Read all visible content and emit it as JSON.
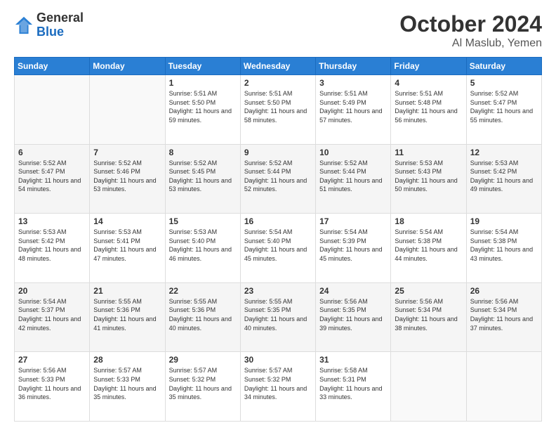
{
  "logo": {
    "general": "General",
    "blue": "Blue"
  },
  "title": "October 2024",
  "location": "Al Maslub, Yemen",
  "days_header": [
    "Sunday",
    "Monday",
    "Tuesday",
    "Wednesday",
    "Thursday",
    "Friday",
    "Saturday"
  ],
  "weeks": [
    [
      {
        "day": "",
        "info": ""
      },
      {
        "day": "",
        "info": ""
      },
      {
        "day": "1",
        "sunrise": "Sunrise: 5:51 AM",
        "sunset": "Sunset: 5:50 PM",
        "daylight": "Daylight: 11 hours and 59 minutes."
      },
      {
        "day": "2",
        "sunrise": "Sunrise: 5:51 AM",
        "sunset": "Sunset: 5:50 PM",
        "daylight": "Daylight: 11 hours and 58 minutes."
      },
      {
        "day": "3",
        "sunrise": "Sunrise: 5:51 AM",
        "sunset": "Sunset: 5:49 PM",
        "daylight": "Daylight: 11 hours and 57 minutes."
      },
      {
        "day": "4",
        "sunrise": "Sunrise: 5:51 AM",
        "sunset": "Sunset: 5:48 PM",
        "daylight": "Daylight: 11 hours and 56 minutes."
      },
      {
        "day": "5",
        "sunrise": "Sunrise: 5:52 AM",
        "sunset": "Sunset: 5:47 PM",
        "daylight": "Daylight: 11 hours and 55 minutes."
      }
    ],
    [
      {
        "day": "6",
        "sunrise": "Sunrise: 5:52 AM",
        "sunset": "Sunset: 5:47 PM",
        "daylight": "Daylight: 11 hours and 54 minutes."
      },
      {
        "day": "7",
        "sunrise": "Sunrise: 5:52 AM",
        "sunset": "Sunset: 5:46 PM",
        "daylight": "Daylight: 11 hours and 53 minutes."
      },
      {
        "day": "8",
        "sunrise": "Sunrise: 5:52 AM",
        "sunset": "Sunset: 5:45 PM",
        "daylight": "Daylight: 11 hours and 53 minutes."
      },
      {
        "day": "9",
        "sunrise": "Sunrise: 5:52 AM",
        "sunset": "Sunset: 5:44 PM",
        "daylight": "Daylight: 11 hours and 52 minutes."
      },
      {
        "day": "10",
        "sunrise": "Sunrise: 5:52 AM",
        "sunset": "Sunset: 5:44 PM",
        "daylight": "Daylight: 11 hours and 51 minutes."
      },
      {
        "day": "11",
        "sunrise": "Sunrise: 5:53 AM",
        "sunset": "Sunset: 5:43 PM",
        "daylight": "Daylight: 11 hours and 50 minutes."
      },
      {
        "day": "12",
        "sunrise": "Sunrise: 5:53 AM",
        "sunset": "Sunset: 5:42 PM",
        "daylight": "Daylight: 11 hours and 49 minutes."
      }
    ],
    [
      {
        "day": "13",
        "sunrise": "Sunrise: 5:53 AM",
        "sunset": "Sunset: 5:42 PM",
        "daylight": "Daylight: 11 hours and 48 minutes."
      },
      {
        "day": "14",
        "sunrise": "Sunrise: 5:53 AM",
        "sunset": "Sunset: 5:41 PM",
        "daylight": "Daylight: 11 hours and 47 minutes."
      },
      {
        "day": "15",
        "sunrise": "Sunrise: 5:53 AM",
        "sunset": "Sunset: 5:40 PM",
        "daylight": "Daylight: 11 hours and 46 minutes."
      },
      {
        "day": "16",
        "sunrise": "Sunrise: 5:54 AM",
        "sunset": "Sunset: 5:40 PM",
        "daylight": "Daylight: 11 hours and 45 minutes."
      },
      {
        "day": "17",
        "sunrise": "Sunrise: 5:54 AM",
        "sunset": "Sunset: 5:39 PM",
        "daylight": "Daylight: 11 hours and 45 minutes."
      },
      {
        "day": "18",
        "sunrise": "Sunrise: 5:54 AM",
        "sunset": "Sunset: 5:38 PM",
        "daylight": "Daylight: 11 hours and 44 minutes."
      },
      {
        "day": "19",
        "sunrise": "Sunrise: 5:54 AM",
        "sunset": "Sunset: 5:38 PM",
        "daylight": "Daylight: 11 hours and 43 minutes."
      }
    ],
    [
      {
        "day": "20",
        "sunrise": "Sunrise: 5:54 AM",
        "sunset": "Sunset: 5:37 PM",
        "daylight": "Daylight: 11 hours and 42 minutes."
      },
      {
        "day": "21",
        "sunrise": "Sunrise: 5:55 AM",
        "sunset": "Sunset: 5:36 PM",
        "daylight": "Daylight: 11 hours and 41 minutes."
      },
      {
        "day": "22",
        "sunrise": "Sunrise: 5:55 AM",
        "sunset": "Sunset: 5:36 PM",
        "daylight": "Daylight: 11 hours and 40 minutes."
      },
      {
        "day": "23",
        "sunrise": "Sunrise: 5:55 AM",
        "sunset": "Sunset: 5:35 PM",
        "daylight": "Daylight: 11 hours and 40 minutes."
      },
      {
        "day": "24",
        "sunrise": "Sunrise: 5:56 AM",
        "sunset": "Sunset: 5:35 PM",
        "daylight": "Daylight: 11 hours and 39 minutes."
      },
      {
        "day": "25",
        "sunrise": "Sunrise: 5:56 AM",
        "sunset": "Sunset: 5:34 PM",
        "daylight": "Daylight: 11 hours and 38 minutes."
      },
      {
        "day": "26",
        "sunrise": "Sunrise: 5:56 AM",
        "sunset": "Sunset: 5:34 PM",
        "daylight": "Daylight: 11 hours and 37 minutes."
      }
    ],
    [
      {
        "day": "27",
        "sunrise": "Sunrise: 5:56 AM",
        "sunset": "Sunset: 5:33 PM",
        "daylight": "Daylight: 11 hours and 36 minutes."
      },
      {
        "day": "28",
        "sunrise": "Sunrise: 5:57 AM",
        "sunset": "Sunset: 5:33 PM",
        "daylight": "Daylight: 11 hours and 35 minutes."
      },
      {
        "day": "29",
        "sunrise": "Sunrise: 5:57 AM",
        "sunset": "Sunset: 5:32 PM",
        "daylight": "Daylight: 11 hours and 35 minutes."
      },
      {
        "day": "30",
        "sunrise": "Sunrise: 5:57 AM",
        "sunset": "Sunset: 5:32 PM",
        "daylight": "Daylight: 11 hours and 34 minutes."
      },
      {
        "day": "31",
        "sunrise": "Sunrise: 5:58 AM",
        "sunset": "Sunset: 5:31 PM",
        "daylight": "Daylight: 11 hours and 33 minutes."
      },
      {
        "day": "",
        "info": ""
      },
      {
        "day": "",
        "info": ""
      }
    ]
  ]
}
